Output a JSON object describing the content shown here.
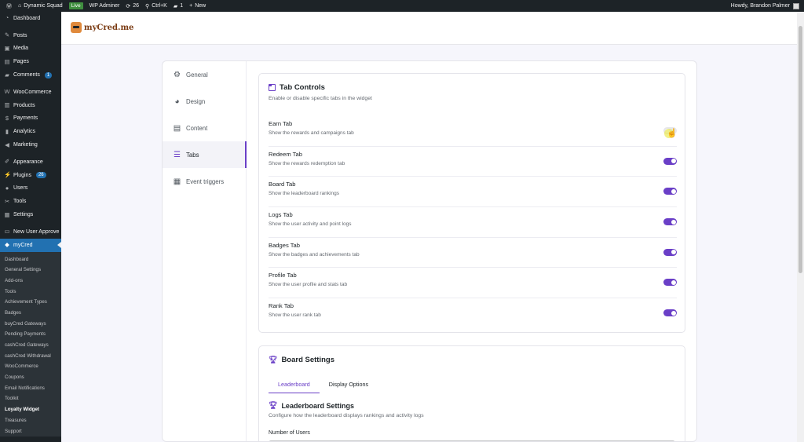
{
  "admin_bar": {
    "site_name": "Dynamic Squad",
    "live_badge": "Live",
    "wp_adminer": "WP Adminer",
    "updates_count": "26",
    "search_shortcut": "Ctrl+K",
    "comments_count": "1",
    "new_label": "New",
    "greeting": "Howdy, Brandon Palmer"
  },
  "sidebar": {
    "items": [
      {
        "label": "Dashboard",
        "icon": "dashboard-icon"
      },
      {
        "label": "Posts",
        "icon": "pin-icon"
      },
      {
        "label": "Media",
        "icon": "media-icon"
      },
      {
        "label": "Pages",
        "icon": "page-icon"
      },
      {
        "label": "Comments",
        "icon": "comment-icon",
        "badge": "1"
      },
      {
        "label": "WooCommerce",
        "icon": "woo-icon"
      },
      {
        "label": "Products",
        "icon": "archive-icon"
      },
      {
        "label": "Payments",
        "icon": "dollar-icon"
      },
      {
        "label": "Analytics",
        "icon": "chart-icon"
      },
      {
        "label": "Marketing",
        "icon": "megaphone-icon"
      },
      {
        "label": "Appearance",
        "icon": "brush-icon"
      },
      {
        "label": "Plugins",
        "icon": "plugin-icon",
        "badge": "26"
      },
      {
        "label": "Users",
        "icon": "user-icon"
      },
      {
        "label": "Tools",
        "icon": "wrench-icon"
      },
      {
        "label": "Settings",
        "icon": "settings-icon"
      },
      {
        "label": "New User Approve",
        "icon": "folder-icon"
      },
      {
        "label": "myCred",
        "icon": "mycred-icon"
      }
    ],
    "submenu": [
      "Dashboard",
      "General Settings",
      "Add-ons",
      "Tools",
      "Achievement Types",
      "Badges",
      "buyCred Gateways",
      "Pending Payments",
      "cashCred Gateways",
      "cashCred Withdrawal",
      "WooCommerce",
      "Coupons",
      "Email Notifications",
      "Toolkit",
      "Loyalty Widget",
      "Treasures",
      "Support"
    ]
  },
  "header": {
    "logo_text": "myCred.me"
  },
  "nav": {
    "items": [
      {
        "label": "General",
        "icon": "gear-icon"
      },
      {
        "label": "Design",
        "icon": "palette-icon"
      },
      {
        "label": "Content",
        "icon": "document-icon"
      },
      {
        "label": "Tabs",
        "icon": "list-icon"
      },
      {
        "label": "Event triggers",
        "icon": "calendar-icon"
      }
    ]
  },
  "tab_controls": {
    "title": "Tab Controls",
    "subtitle": "Enable or disable specific tabs in the widget",
    "rows": [
      {
        "name": "Earn Tab",
        "desc": "Show the rewards and campaigns tab",
        "enabled": false
      },
      {
        "name": "Redeem Tab",
        "desc": "Show the rewards redemption tab",
        "enabled": true
      },
      {
        "name": "Board Tab",
        "desc": "Show the leaderboard rankings",
        "enabled": true
      },
      {
        "name": "Logs Tab",
        "desc": "Show the user activity and point logs",
        "enabled": true
      },
      {
        "name": "Badges Tab",
        "desc": "Show the badges and achievements tab",
        "enabled": true
      },
      {
        "name": "Profile Tab",
        "desc": "Show the user profile and stats tab",
        "enabled": true
      },
      {
        "name": "Rank Tab",
        "desc": "Show the user rank tab",
        "enabled": true
      }
    ]
  },
  "board_settings": {
    "title": "Board Settings",
    "tabs": [
      "Leaderboard",
      "Display Options"
    ],
    "section_title": "Leaderboard Settings",
    "section_subtitle": "Configure how the leaderboard displays rankings and activity logs",
    "field_label": "Number of Users"
  },
  "colors": {
    "accent": "#6a3fc7",
    "wp_dark": "#1d2327",
    "wp_blue": "#2271b1"
  }
}
